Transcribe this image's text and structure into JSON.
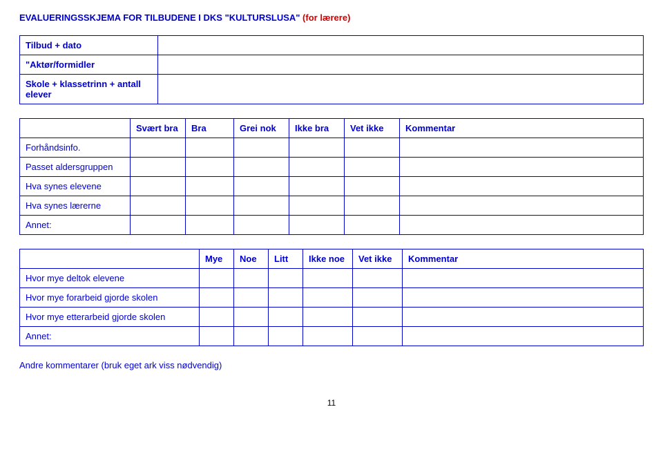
{
  "title": {
    "main": "EVALUERINGSSKJEMA FOR TILBUDENE I DKS \"KULTURSLUSA\" ",
    "sub": "(for lærere)"
  },
  "info": {
    "tilbud": "Tilbud + dato",
    "aktor": "\"Aktør/formidler",
    "skole": "Skole + klassetrinn + antall elever"
  },
  "rating": {
    "headers": {
      "svaert_bra": "Svært bra",
      "bra": "Bra",
      "grei_nok": "Grei nok",
      "ikke_bra": "Ikke bra",
      "vet_ikke": "Vet ikke",
      "kommentar": "Kommentar"
    },
    "rows": {
      "forhand": "Forhåndsinfo.",
      "passet": "Passet aldersgruppen",
      "elevene": "Hva synes elevene",
      "laererne": "Hva synes lærerne",
      "annet": "Annet:"
    }
  },
  "participation": {
    "headers": {
      "mye": "Mye",
      "noe": "Noe",
      "litt": "Litt",
      "ikke_noe": "Ikke noe",
      "vet_ikke": "Vet ikke",
      "kommentar": "Kommentar"
    },
    "rows": {
      "deltok": "Hvor mye deltok elevene",
      "forarbeid": "Hvor mye forarbeid gjorde skolen",
      "etterarbeid": "Hvor mye etterarbeid gjorde skolen",
      "annet": "Annet:"
    }
  },
  "footer": "Andre kommentarer (bruk eget ark viss nødvendig)",
  "page": "11"
}
